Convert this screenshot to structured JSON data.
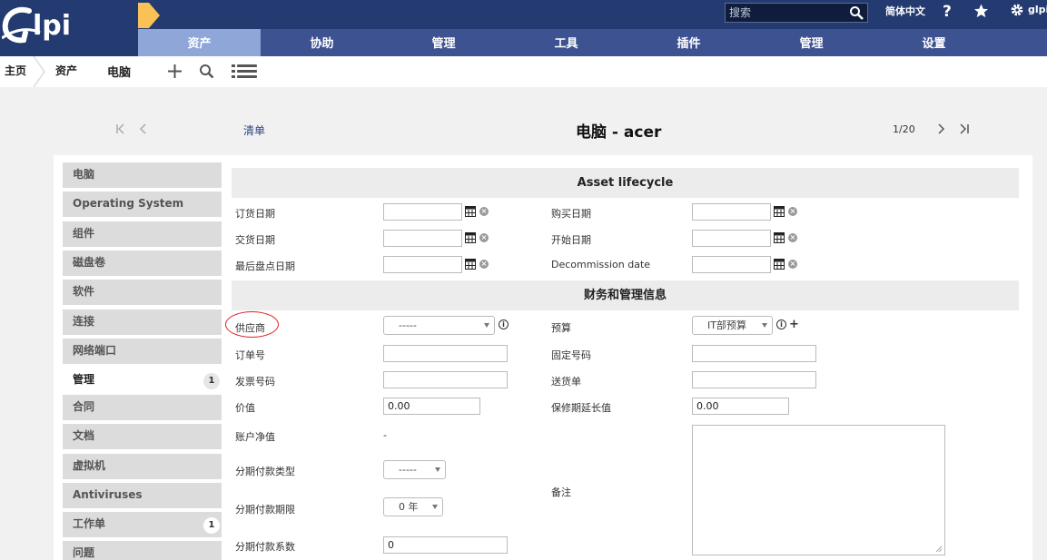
{
  "app": {
    "logo_text": "Glpi"
  },
  "topbar": {
    "search_placeholder": "搜索",
    "language": "简体中文",
    "user": "glpi",
    "help_icon": "help-icon",
    "star_icon": "star-icon",
    "gear_icon": "gear-icon"
  },
  "mainnav": [
    "资产",
    "协助",
    "管理",
    "工具",
    "插件",
    "管理",
    "设置"
  ],
  "breadcrumb": [
    "主页",
    "资产",
    "电脑"
  ],
  "record": {
    "list_link": "清单",
    "title": "电脑 - acer",
    "counter": "1/20"
  },
  "tabs": [
    {
      "label": "电脑",
      "badge": ""
    },
    {
      "label": "Operating System",
      "badge": ""
    },
    {
      "label": "组件",
      "badge": ""
    },
    {
      "label": "磁盘卷",
      "badge": ""
    },
    {
      "label": "软件",
      "badge": ""
    },
    {
      "label": "连接",
      "badge": ""
    },
    {
      "label": "网络端口",
      "badge": ""
    },
    {
      "label": "管理",
      "badge": "1"
    },
    {
      "label": "合同",
      "badge": ""
    },
    {
      "label": "文档",
      "badge": ""
    },
    {
      "label": "虚拟机",
      "badge": ""
    },
    {
      "label": "Antiviruses",
      "badge": ""
    },
    {
      "label": "工作单",
      "badge": "1"
    },
    {
      "label": "问题",
      "badge": ""
    }
  ],
  "sections": {
    "lifecycle": "Asset lifecycle",
    "finance": "财务和管理信息"
  },
  "lifecycle": {
    "order_date": "订货日期",
    "buy_date": "购买日期",
    "delivery_date": "交货日期",
    "start_date": "开始日期",
    "inventory_date": "最后盘点日期",
    "decommission_date": "Decommission date"
  },
  "finance": {
    "supplier_label": "供应商",
    "supplier_value": "-----",
    "budget_label": "预算",
    "budget_value": "IT部预算",
    "order_number_label": "订单号",
    "immo_number_label": "固定号码",
    "invoice_label": "发票号码",
    "delivery_note_label": "送货单",
    "value_label": "价值",
    "value_value": "0.00",
    "warranty_value_label": "保修期延长值",
    "warranty_value_value": "0.00",
    "net_value_label": "账户净值",
    "net_value_value": "-",
    "amort_type_label": "分期付款类型",
    "amort_type_value": "-----",
    "amort_time_label": "分期付款期限",
    "amort_time_value": "0 年",
    "amort_coeff_label": "分期付款系数",
    "amort_coeff_value": "0",
    "comment_label": "备注"
  },
  "colors": {
    "topbar": "#243B71",
    "nav": "#3d5291",
    "nav_active": "#8ea7d8",
    "breadcrumb_active": "#f9c156"
  }
}
